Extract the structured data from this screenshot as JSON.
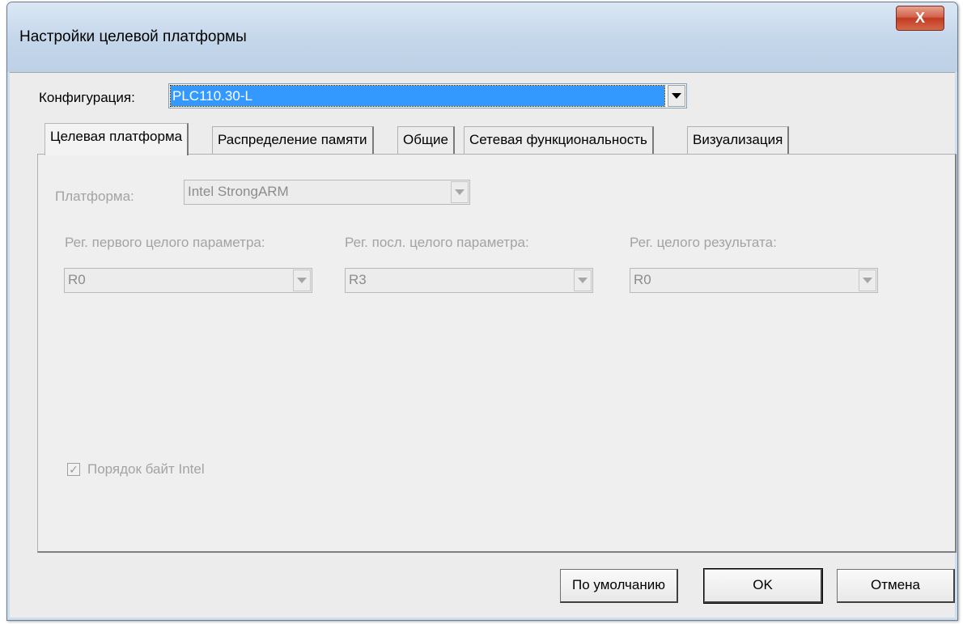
{
  "window": {
    "title": "Настройки целевой платформы",
    "close_glyph": "X"
  },
  "config": {
    "label": "Конфигурация:",
    "value": "PLC110.30-L"
  },
  "tabs": [
    {
      "label": "Целевая платформа",
      "active": true
    },
    {
      "label": "Распределение памяти",
      "active": false
    },
    {
      "label": "Общие",
      "active": false
    },
    {
      "label": "Сетевая функциональность",
      "active": false
    },
    {
      "label": "Визуализация",
      "active": false
    }
  ],
  "panel": {
    "platform_label": "Платформа:",
    "platform_value": "Intel StrongARM",
    "reg_first_label": "Рег. первого целого параметра:",
    "reg_first_value": "R0",
    "reg_last_label": "Рег. посл. целого параметра:",
    "reg_last_value": "R3",
    "reg_result_label": "Рег. целого результата:",
    "reg_result_value": "R0",
    "byte_order_label": "Порядок байт Intel",
    "byte_order_checked": true
  },
  "buttons": {
    "defaults": "По умолчанию",
    "ok": "OK",
    "cancel": "Отмена"
  },
  "colors": {
    "selection": "#3399ff",
    "disabled_text": "#a3a3a3",
    "close_button": "#c23a22"
  }
}
